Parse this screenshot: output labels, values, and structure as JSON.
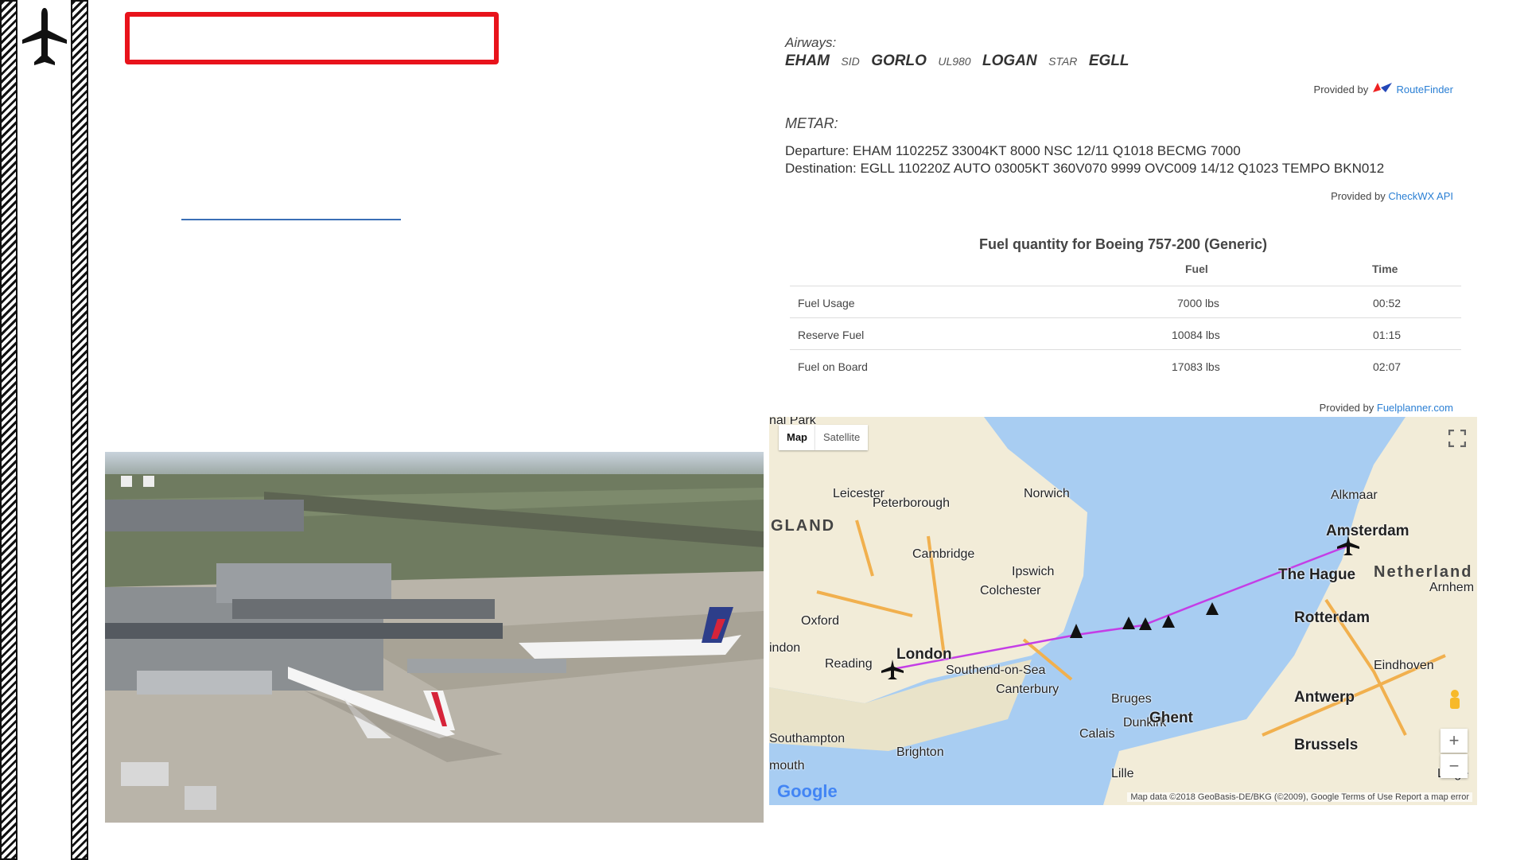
{
  "airways": {
    "label": "Airways:",
    "route": [
      {
        "text": "EHAM",
        "kind": "big"
      },
      {
        "text": "SID",
        "kind": "small"
      },
      {
        "text": "GORLO",
        "kind": "big"
      },
      {
        "text": "UL980",
        "kind": "small"
      },
      {
        "text": "LOGAN",
        "kind": "big"
      },
      {
        "text": "STAR",
        "kind": "small"
      },
      {
        "text": "EGLL",
        "kind": "big"
      }
    ],
    "provided_prefix": "Provided by",
    "provider": "RouteFinder"
  },
  "metar": {
    "label": "METAR:",
    "departure": "Departure: EHAM 110225Z 33004KT 8000 NSC 12/11 Q1018 BECMG 7000",
    "destination": "Destination: EGLL 110220Z AUTO 03005KT 360V070 9999 OVC009 14/12 Q1023 TEMPO BKN012",
    "provided_prefix": "Provided by",
    "provider": "CheckWX API"
  },
  "fuel": {
    "title": "Fuel quantity for Boeing 757-200 (Generic)",
    "col_fuel": "Fuel",
    "col_time": "Time",
    "rows": [
      {
        "label": "Fuel Usage",
        "fuel": "7000 lbs",
        "time": "00:52"
      },
      {
        "label": "Reserve Fuel",
        "fuel": "10084 lbs",
        "time": "01:15"
      },
      {
        "label": "Fuel on Board",
        "fuel": "17083 lbs",
        "time": "02:07"
      }
    ],
    "provided_prefix": "Provided by",
    "provider": "Fuelplanner.com"
  },
  "map": {
    "tab_map": "Map",
    "tab_satellite": "Satellite",
    "zoom_in": "+",
    "zoom_out": "−",
    "attribution": "Map data ©2018 GeoBasis-DE/BKG (©2009), Google   Terms of Use   Report a map error",
    "logo": "Google",
    "labels": {
      "nal_park": "nal Park",
      "leicester": "Leicester",
      "peterborough": "Peterborough",
      "norwich": "Norwich",
      "england": "GLAND",
      "cambridge": "Cambridge",
      "ipswich": "Ipswich",
      "colchester": "Colchester",
      "oxford": "Oxford",
      "london": "London",
      "reading": "Reading",
      "southend": "Southend-on-Sea",
      "canterbury": "Canterbury",
      "indon": "indon",
      "southampton": "Southampton",
      "brighton": "Brighton",
      "mouth": "mouth",
      "calais": "Calais",
      "dunkirk": "Dunkirk",
      "bruges": "Bruges",
      "ghent": "Ghent",
      "brussels": "Brussels",
      "antwerp": "Antwerp",
      "lille": "Lille",
      "liege": "Liège",
      "eindhoven": "Eindhoven",
      "rotterdam": "Rotterdam",
      "the_hague": "The Hague",
      "amsterdam": "Amsterdam",
      "alkmaar": "Alkmaar",
      "netherlands": "Netherland",
      "arnhem": "Arnhem"
    }
  }
}
